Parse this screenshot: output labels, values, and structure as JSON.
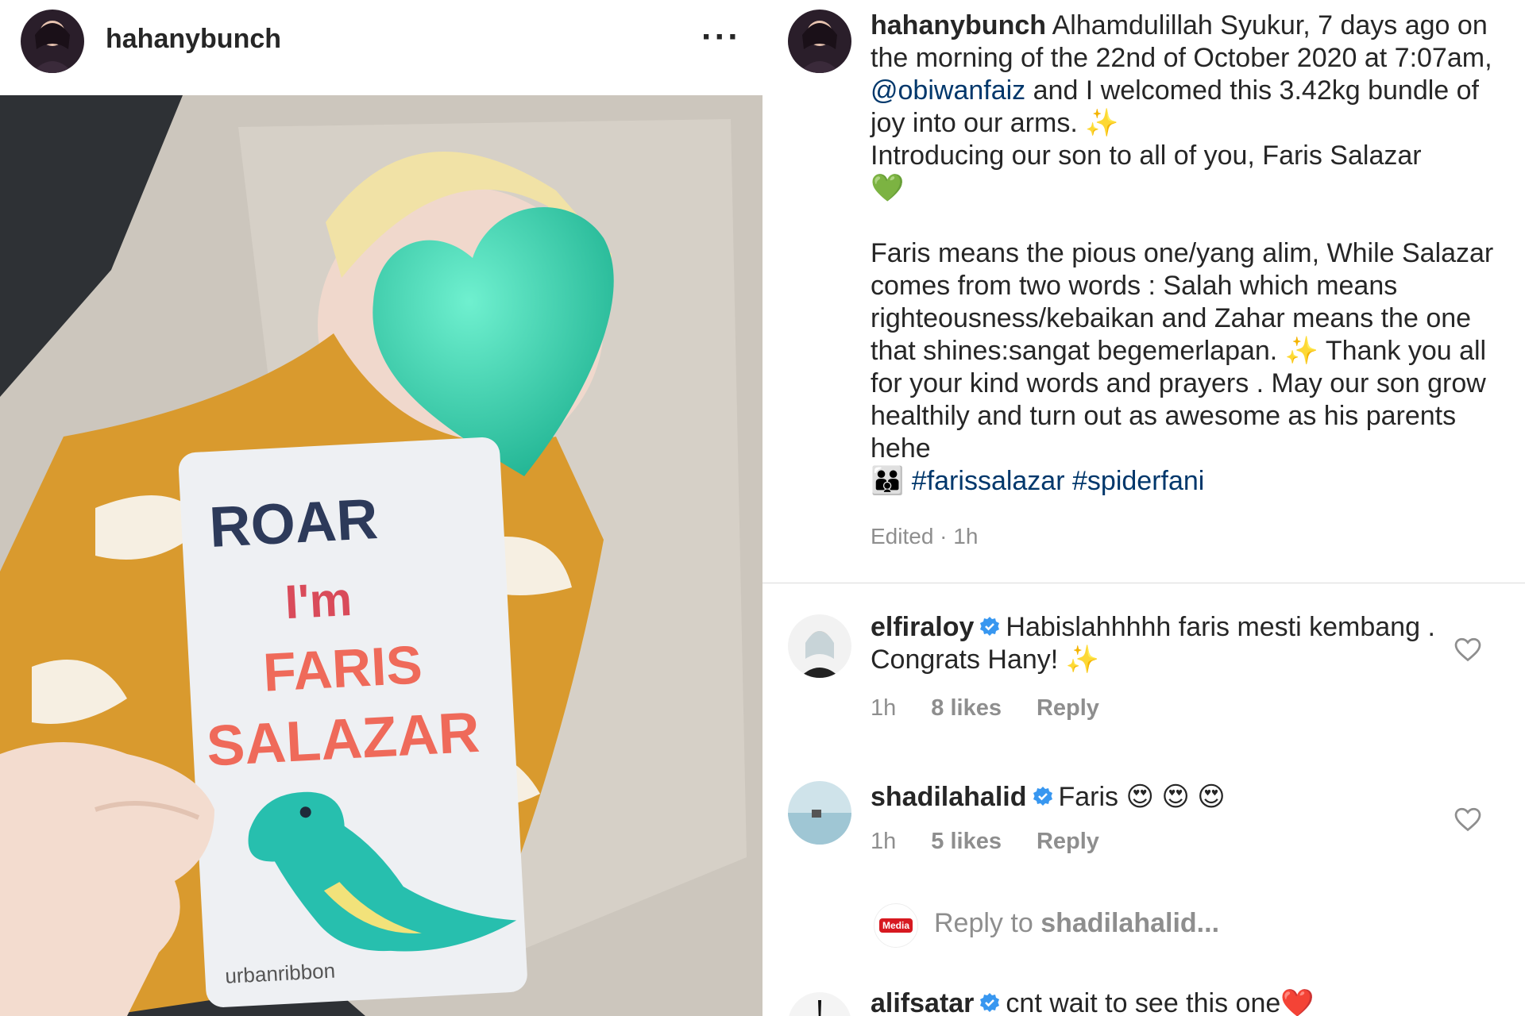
{
  "post": {
    "username": "hahanybunch",
    "more_icon": "more-horizontal-icon"
  },
  "photo": {
    "card_roar": "ROAR",
    "card_im": "I'm",
    "card_name1": "FARIS",
    "card_name2": "SALAZAR",
    "card_brand": "urbanribbon"
  },
  "caption": {
    "username": "hahanybunch",
    "text1": "Alhamdulillah Syukur, 7 days ago on the morning of the 22nd of October 2020 at 7:07am,",
    "mention": "@obiwanfaiz",
    "text2": "and I welcomed this 3.42kg bundle of joy into our arms.",
    "emoji_sparkle": "✨",
    "text3": "Introducing our son to all of you, Faris Salazar",
    "emoji_heart": "💚",
    "para2": "Faris means the pious one/yang alim, While Salazar comes from two words : Salah which means righteousness/kebaikan and Zahar means the one that shines:sangat begemerlapan.",
    "para2b": "Thank you all for your kind words and prayers . May our son grow healthily and turn out as awesome as his parents hehe",
    "emoji_family": "👪",
    "hashtag1": "#farissalazar",
    "hashtag2": "#spiderfani",
    "edited": "Edited · 1h"
  },
  "comments": [
    {
      "username": "elfiraloy",
      "verified": true,
      "text": "Habislahhhhh faris mesti kembang . Congrats Hany!",
      "emoji": "✨",
      "time": "1h",
      "likes": "8 likes",
      "reply_label": "Reply"
    },
    {
      "username": "shadilahalid",
      "verified": true,
      "text": "Faris",
      "emoji": "😍 😍 😍",
      "time": "1h",
      "likes": "5 likes",
      "reply_label": "Reply"
    },
    {
      "username": "alifsatar",
      "verified": true,
      "text": "cnt wait to see this one",
      "emoji": "❤️"
    }
  ],
  "reply_box": {
    "prefix": "Reply to",
    "target": "shadilahalid...",
    "badge": "Media"
  },
  "colors": {
    "link": "#00376b",
    "muted": "#8e8e8e",
    "verified": "#3897f0",
    "heart_mask": "#2fc6a4"
  }
}
